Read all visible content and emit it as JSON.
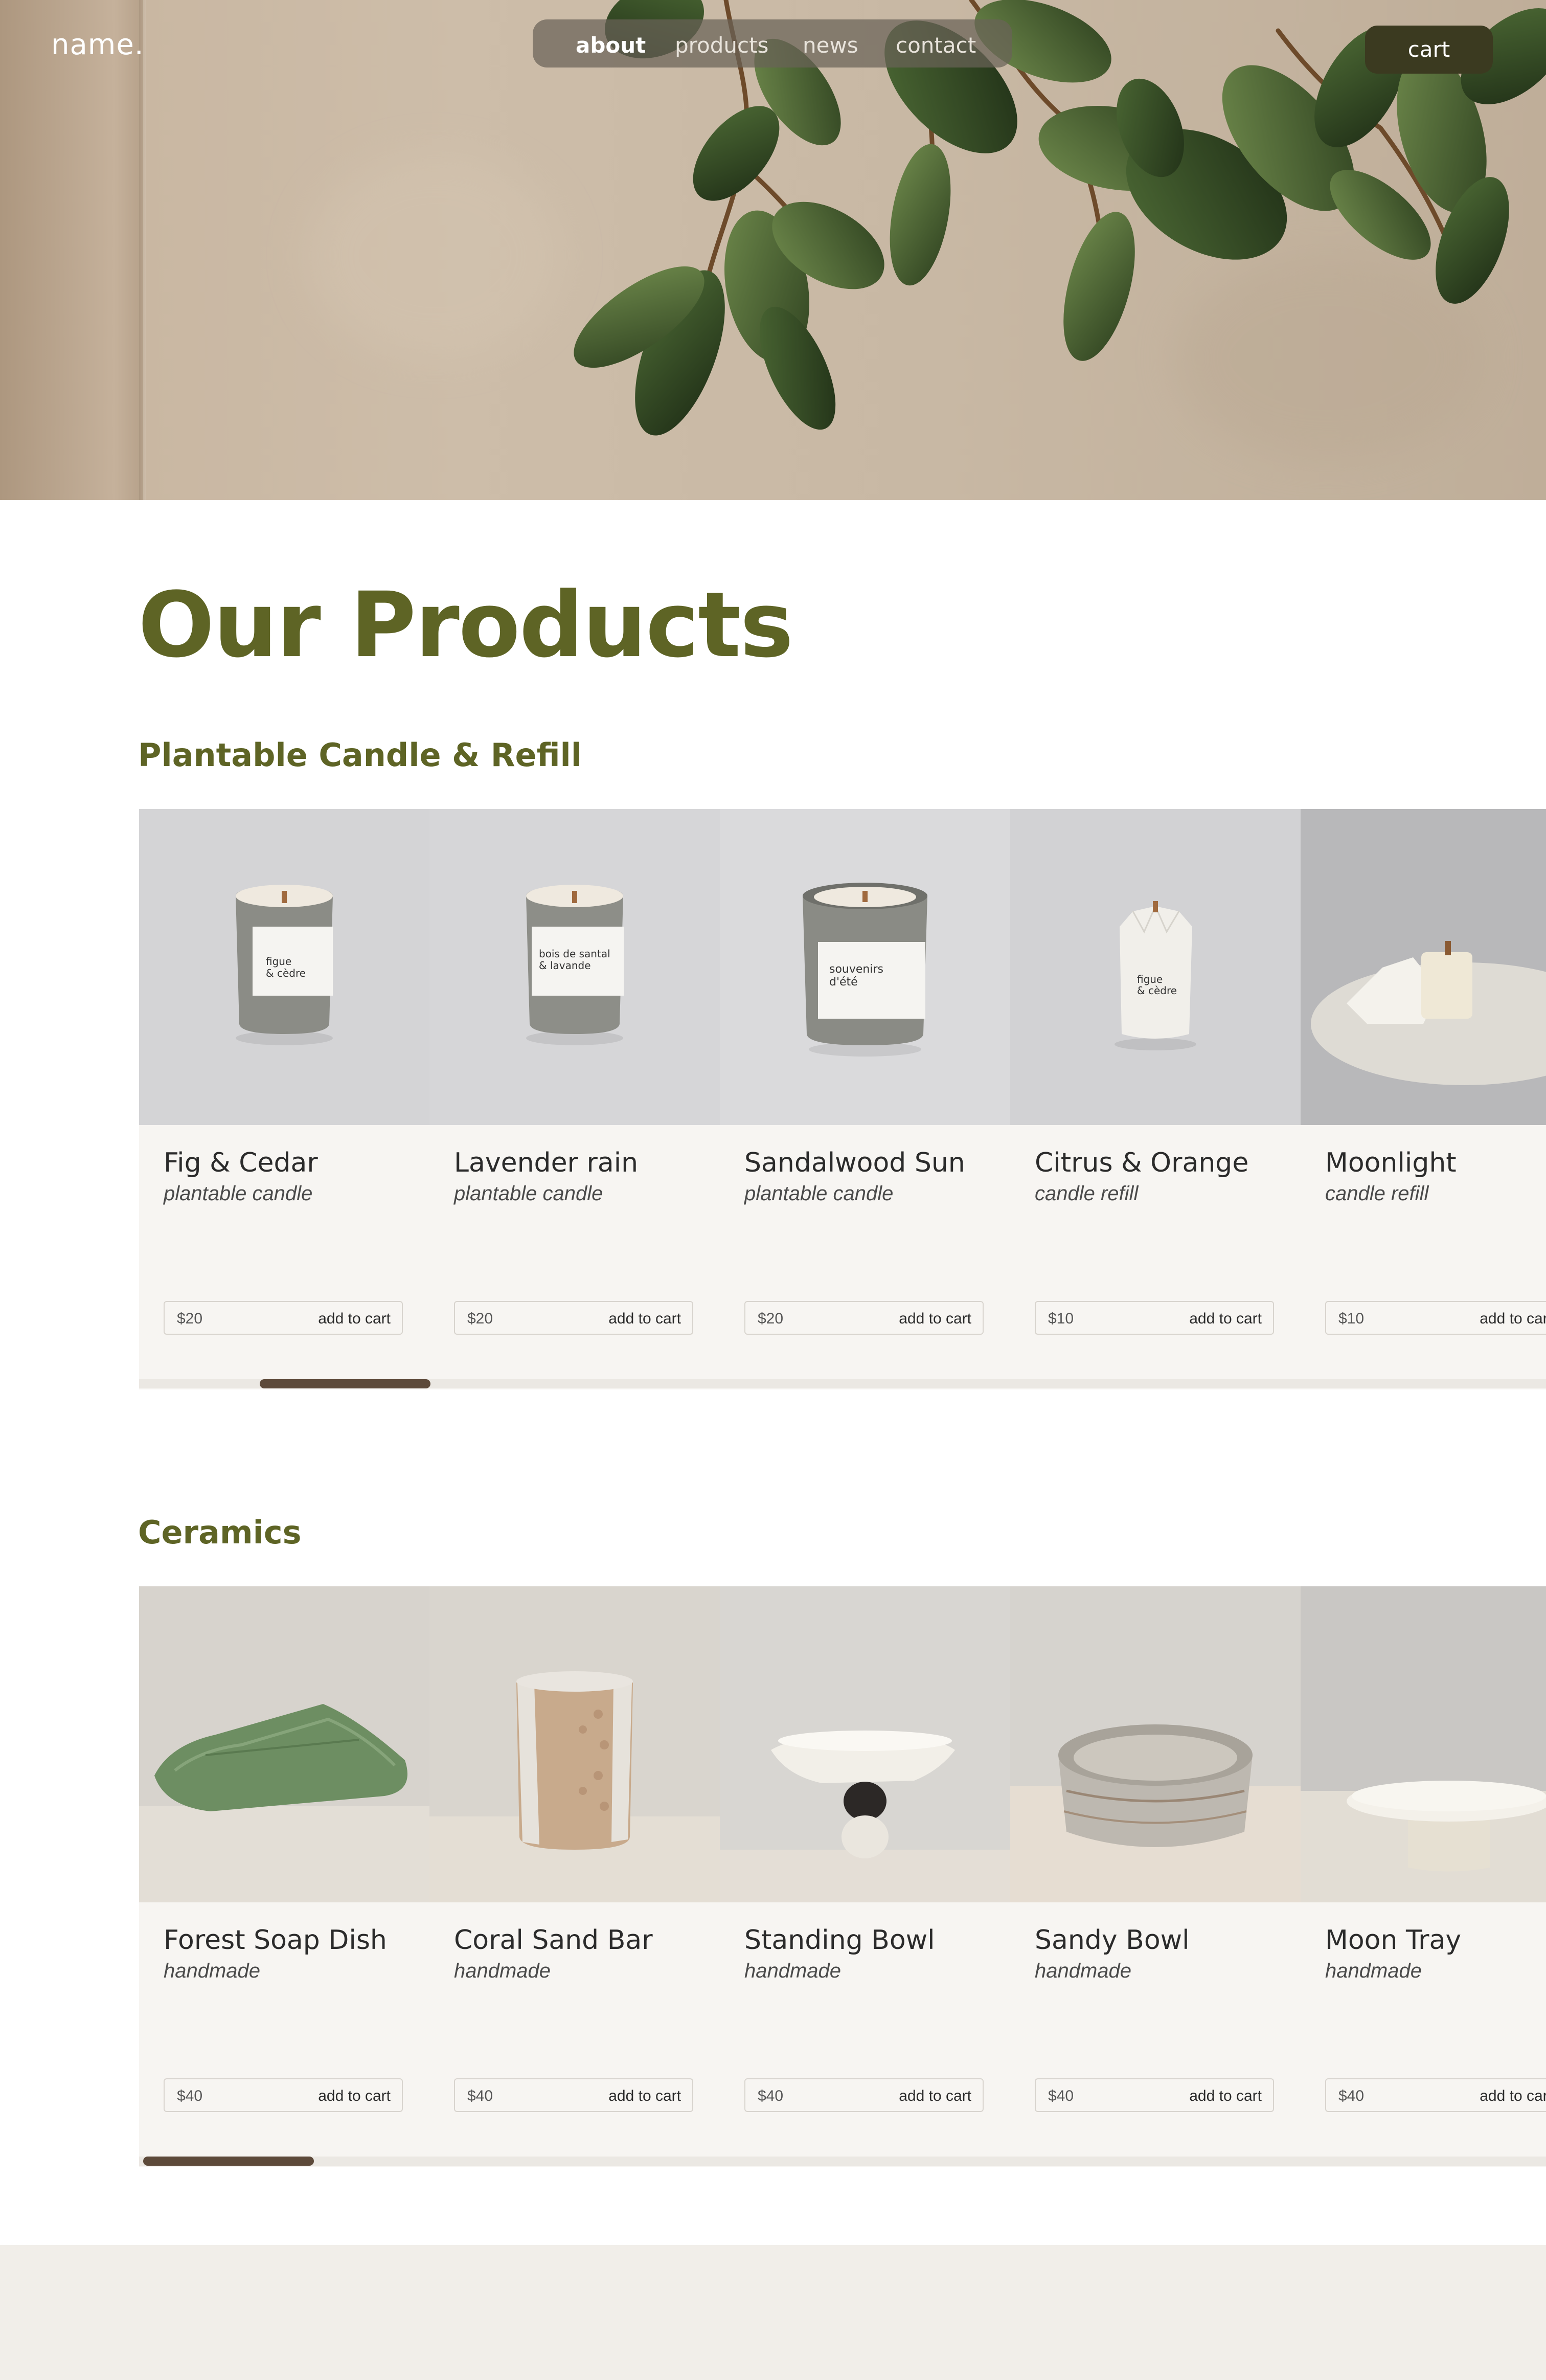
{
  "header": {
    "brand": "name.",
    "nav": [
      {
        "label": "about",
        "active": true
      },
      {
        "label": "products",
        "active": false
      },
      {
        "label": "news",
        "active": false
      },
      {
        "label": "contact",
        "active": false
      }
    ],
    "cart_label": "cart"
  },
  "main": {
    "title": "Our Products",
    "sections": [
      {
        "title": "Plantable Candle & Refill",
        "items": [
          {
            "name": "Fig & Cedar",
            "subtitle": "plantable candle",
            "price": "$20",
            "button": "add to cart",
            "label_lines": [
              "figue",
              "& cèdre"
            ]
          },
          {
            "name": "Lavender rain",
            "subtitle": "plantable candle",
            "price": "$20",
            "button": "add to cart",
            "label_lines": [
              "bois de santal",
              "& lavande"
            ]
          },
          {
            "name": "Sandalwood Sun",
            "subtitle": "plantable candle",
            "price": "$20",
            "button": "add to cart",
            "label_lines": [
              "souvenirs",
              "d'été"
            ]
          },
          {
            "name": "Citrus & Orange",
            "subtitle": "candle refill",
            "price": "$10",
            "button": "add to cart",
            "label_lines": [
              "figue",
              "& cèdre"
            ]
          },
          {
            "name": "Moonlight",
            "subtitle": "candle refill",
            "price": "$10",
            "button": "add to cart"
          }
        ],
        "scroll_position": 0.15
      },
      {
        "title": "Ceramics",
        "items": [
          {
            "name": "Forest Soap Dish",
            "subtitle": "handmade",
            "price": "$40",
            "button": "add to cart"
          },
          {
            "name": "Coral Sand Bar",
            "subtitle": "handmade",
            "price": "$40",
            "button": "add to cart"
          },
          {
            "name": "Standing Bowl",
            "subtitle": "handmade",
            "price": "$40",
            "button": "add to cart"
          },
          {
            "name": "Sandy Bowl",
            "subtitle": "handmade",
            "price": "$40",
            "button": "add to cart"
          },
          {
            "name": "Moon Tray",
            "subtitle": "handmade",
            "price": "$40",
            "button": "add to cart"
          }
        ],
        "scroll_position": 0.0
      }
    ]
  },
  "colors": {
    "brand_green": "#5e6425",
    "cart_button": "#3b3a20",
    "scroll_thumb": "#5d4a3a",
    "card_bg": "#f7f5f2",
    "footer_bg": "#f1eee9"
  }
}
